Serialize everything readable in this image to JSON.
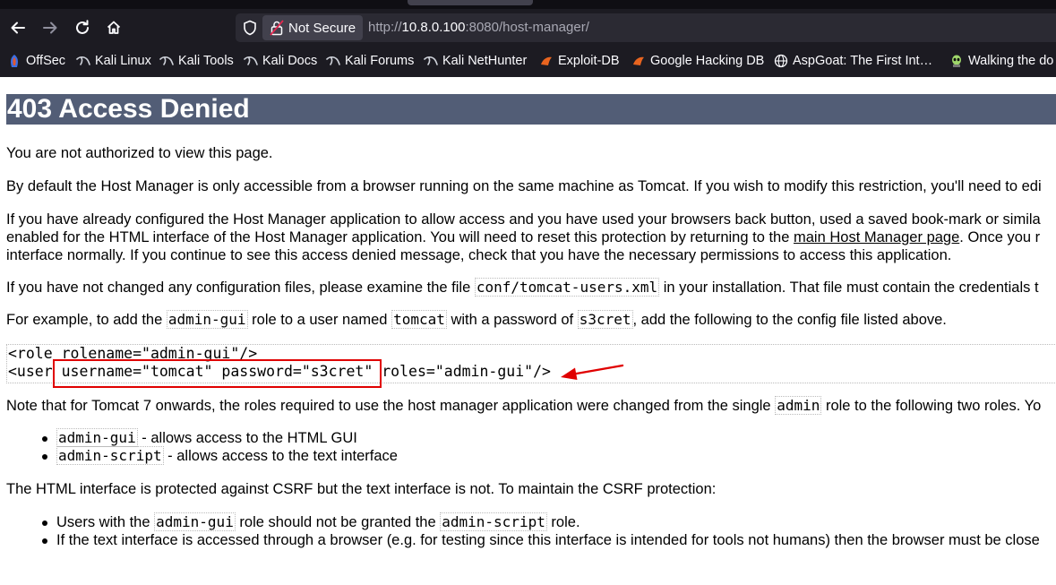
{
  "browser": {
    "security_label": "Not Secure",
    "url_scheme": "http://",
    "url_host": "10.8.0.100",
    "url_rest": ":8080/host-manager/",
    "bookmarks": [
      {
        "label": "OffSec",
        "icon": "offsec-icon"
      },
      {
        "label": "Kali Linux",
        "icon": "kali-dragon-icon"
      },
      {
        "label": "Kali Tools",
        "icon": "kali-dragon-icon"
      },
      {
        "label": "Kali Docs",
        "icon": "kali-dragon-icon"
      },
      {
        "label": "Kali Forums",
        "icon": "kali-dragon-icon"
      },
      {
        "label": "Kali NetHunter",
        "icon": "kali-dragon-icon"
      },
      {
        "label": "Exploit-DB",
        "icon": "exploit-db-icon"
      },
      {
        "label": "Google Hacking DB",
        "icon": "exploit-db-icon"
      },
      {
        "label": "AspGoat: The First Int…",
        "icon": "globe-icon"
      },
      {
        "label": "Walking the do",
        "icon": "alien-icon"
      }
    ]
  },
  "page": {
    "title": "403 Access Denied",
    "p1": "You are not authorized to view this page.",
    "p2": "By default the Host Manager is only accessible from a browser running on the same machine as Tomcat. If you wish to modify this restriction, you'll need to edi",
    "p3_line1": "If you have already configured the Host Manager application to allow access and you have used your browsers back button, used a saved book-mark or simila",
    "p3_line2_a": "enabled for the HTML interface of the Host Manager application. You will need to reset this protection by returning to the ",
    "p3_link": "main Host Manager page",
    "p3_line2_b": ". Once you r",
    "p3_line3": "interface normally. If you continue to see this access denied message, check that you have the necessary permissions to access this application.",
    "p4_a": "If you have not changed any configuration files, please examine the file ",
    "p4_code": "conf/tomcat-users.xml",
    "p4_b": " in your installation. That file must contain the credentials t",
    "p5_a": "For example, to add the ",
    "p5_code1": "admin-gui",
    "p5_b": " role to a user named ",
    "p5_code2": "tomcat",
    "p5_c": " with a password of ",
    "p5_code3": "s3cret",
    "p5_d": ", add the following to the config file listed above.",
    "code_line1": "<role rolename=\"admin-gui\"/>",
    "code_line2": "<user username=\"tomcat\" password=\"s3cret\" roles=\"admin-gui\"/>",
    "p6_a": "Note that for Tomcat 7 onwards, the roles required to use the host manager application were changed from the single ",
    "p6_code": "admin",
    "p6_b": " role to the following two roles. Yo",
    "roles": [
      {
        "code": "admin-gui",
        "desc": " - allows access to the HTML GUI"
      },
      {
        "code": "admin-script",
        "desc": " - allows access to the text interface"
      }
    ],
    "p7": "The HTML interface is protected against CSRF but the text interface is not. To maintain the CSRF protection:",
    "csrf_1_a": "Users with the ",
    "csrf_1_code1": "admin-gui",
    "csrf_1_b": " role should not be granted the ",
    "csrf_1_code2": "admin-script",
    "csrf_1_c": " role.",
    "csrf_2": "If the text interface is accessed through a browser (e.g. for testing since this interface is intended for tools not humans) then the browser must be close"
  },
  "annotation": {
    "highlight_color": "#e00000"
  }
}
